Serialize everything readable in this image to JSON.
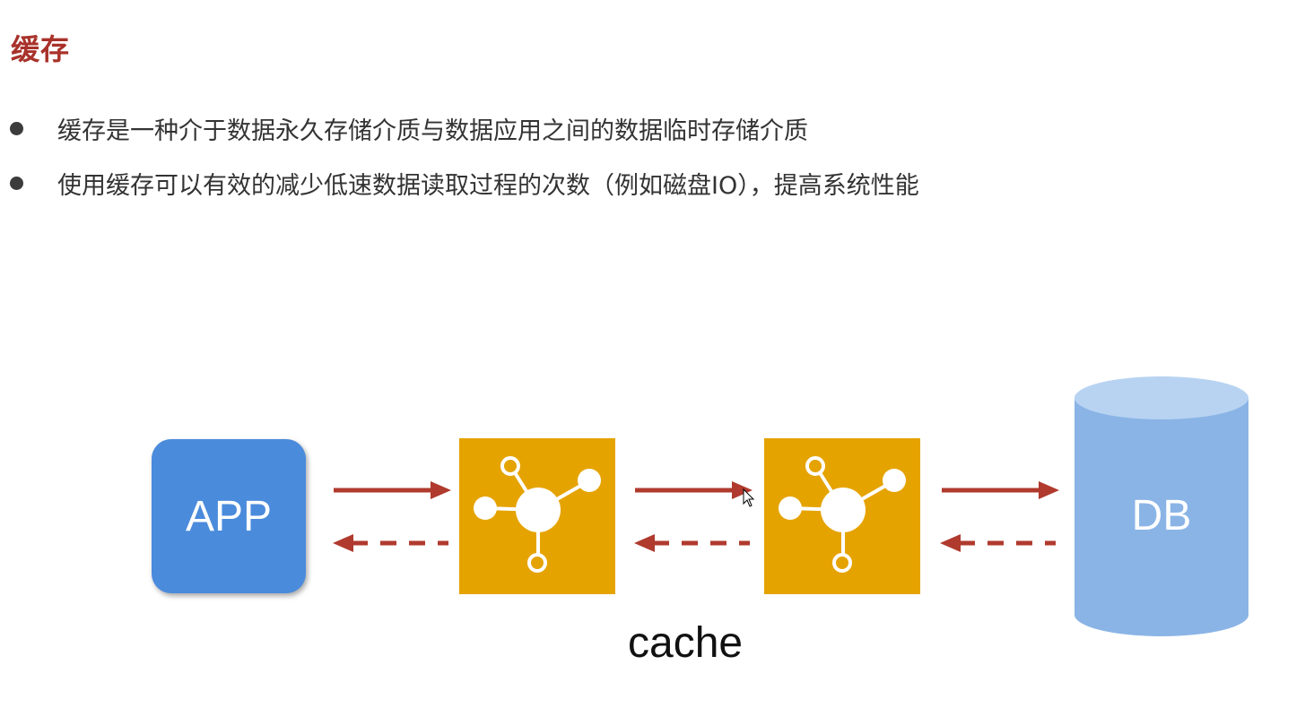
{
  "slide": {
    "title": "缓存",
    "bullets": [
      "缓存是一种介于数据永久存储介质与数据应用之间的数据临时存储介质",
      "使用缓存可以有效的减少低速数据读取过程的次数（例如磁盘IO），提高系统性能"
    ]
  },
  "diagram": {
    "app_label": "APP",
    "cache_label": "cache",
    "db_label": "DB",
    "colors": {
      "title": "#a8322a",
      "app": "#4a8bdc",
      "cache": "#e5a300",
      "db": "#8ab4e6",
      "arrow": "#b03a2e"
    },
    "icons": [
      "hub-icon",
      "hub-icon",
      "database-icon"
    ]
  }
}
